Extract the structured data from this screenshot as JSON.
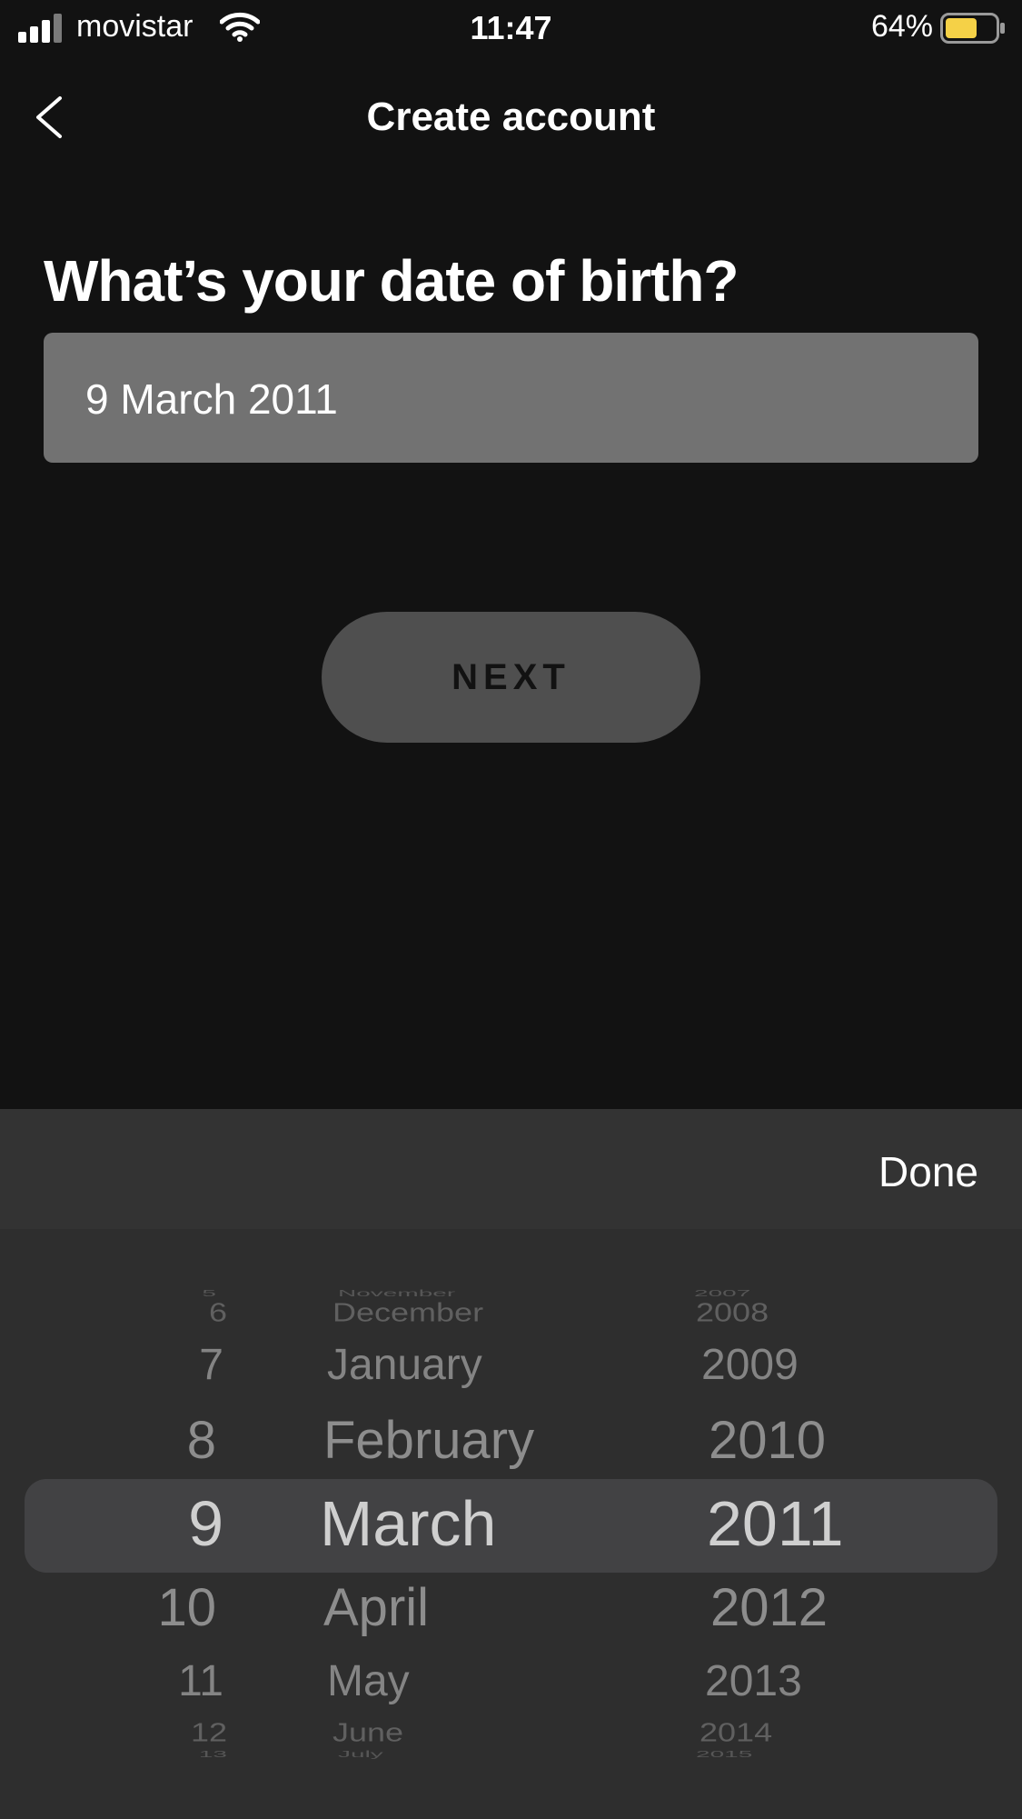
{
  "status_bar": {
    "carrier": "movistar",
    "time": "11:47",
    "battery_percent": "64%",
    "battery_level": 0.64,
    "battery_color": "#f5d147",
    "icons": [
      "signal-icon",
      "wifi-icon",
      "battery-icon"
    ]
  },
  "nav": {
    "title": "Create account",
    "back_icon": "chevron-left-icon"
  },
  "question": "What’s your date of birth?",
  "date_field": {
    "value": "9 March 2011"
  },
  "next_button": {
    "label": "NEXT"
  },
  "picker": {
    "done_label": "Done",
    "days": [
      "5",
      "6",
      "7",
      "8",
      "9",
      "10",
      "11",
      "12",
      "13"
    ],
    "months": [
      "November",
      "December",
      "January",
      "February",
      "March",
      "April",
      "May",
      "June",
      "July"
    ],
    "years": [
      "2007",
      "2008",
      "2009",
      "2010",
      "2011",
      "2012",
      "2013",
      "2014",
      "2015"
    ],
    "selected": {
      "day": "9",
      "month": "March",
      "year": "2011"
    }
  }
}
